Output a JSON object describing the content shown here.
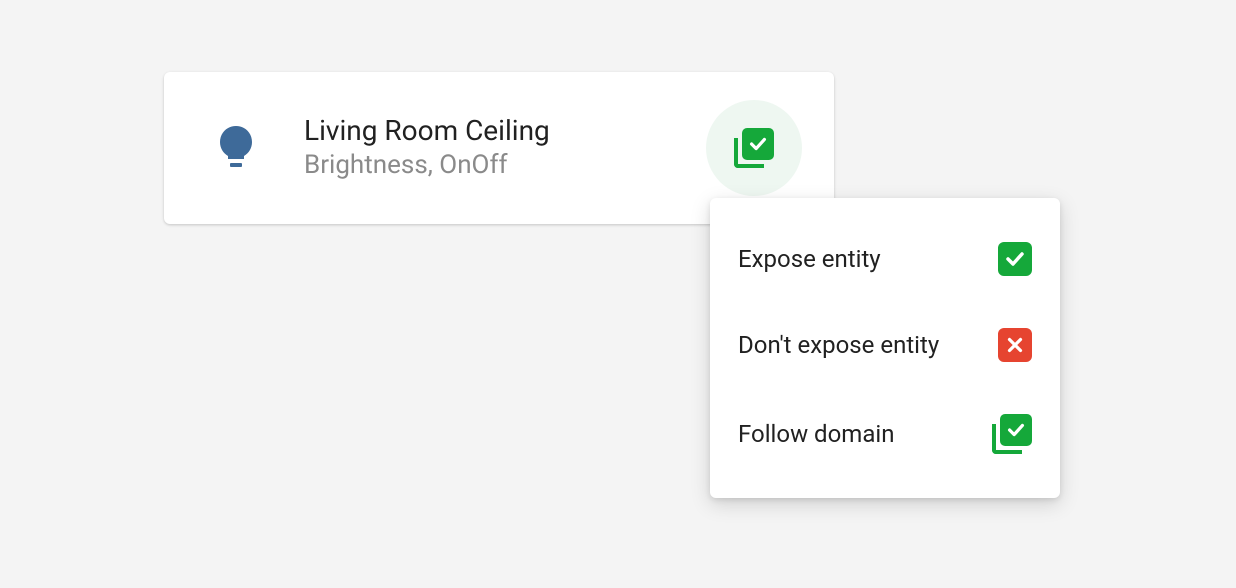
{
  "entity": {
    "title": "Living Room Ceiling",
    "subtitle": "Brightness, OnOff"
  },
  "dropdown": {
    "items": [
      {
        "label": "Expose entity"
      },
      {
        "label": "Don't expose entity"
      },
      {
        "label": "Follow domain"
      }
    ]
  }
}
